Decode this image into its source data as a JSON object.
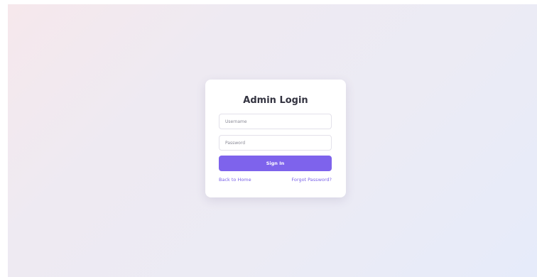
{
  "login": {
    "title": "Admin Login",
    "username_placeholder": "Username",
    "password_placeholder": "Password",
    "submit_label": "Sign In",
    "back_link": "Back to Home",
    "forgot_link": "Forgot Password?"
  },
  "colors": {
    "accent": "#7e63ec",
    "link": "#7a62e8",
    "card_background": "#ffffff"
  }
}
